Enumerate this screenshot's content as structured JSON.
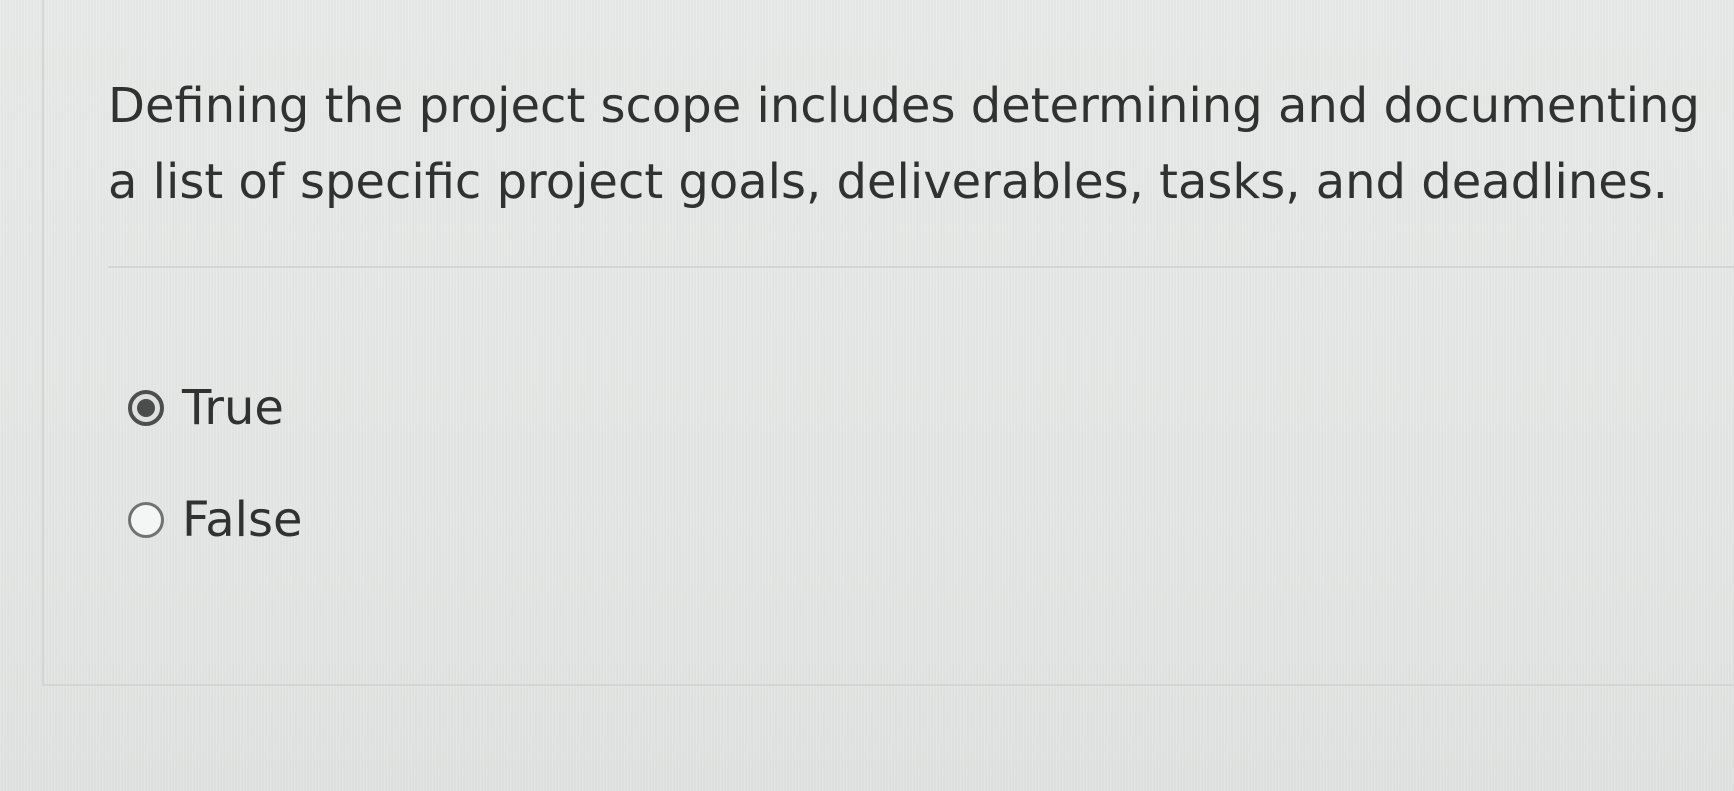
{
  "question": {
    "text": "Defining the project scope includes determining and documenting a list of specific project goals, deliverables, tasks, and deadlines."
  },
  "options": [
    {
      "label": "True",
      "selected": true
    },
    {
      "label": "False",
      "selected": false
    }
  ],
  "colors": {
    "background": "#e6e8e7",
    "text": "#2f3231",
    "radio_border": "#6f7372",
    "divider": "#d2d5d4"
  }
}
